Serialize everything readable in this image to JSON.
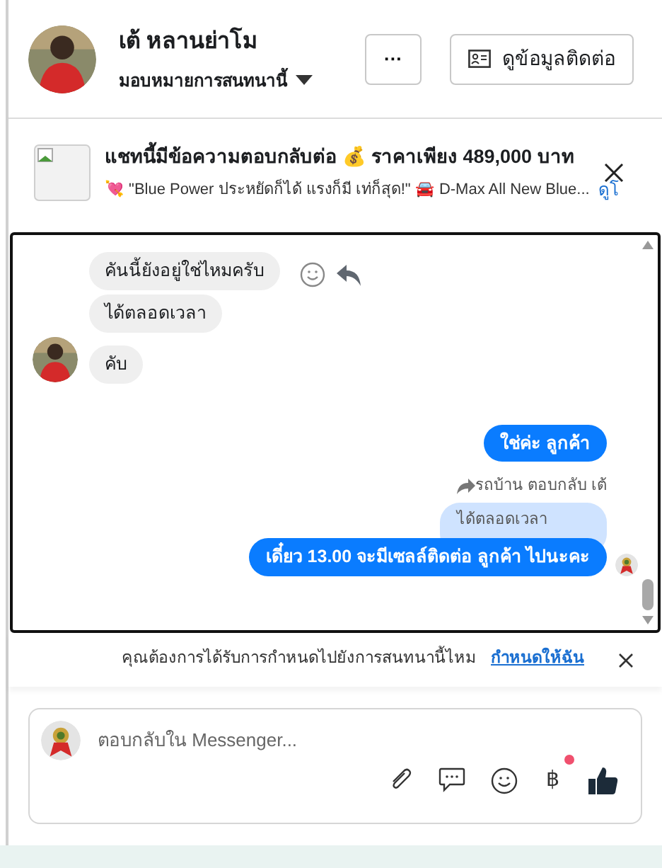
{
  "header": {
    "name": "เต้ หลานย่าโม",
    "assign_label": "มอบหมายการสนทนานี้",
    "more_button": "···",
    "contact_button": "ดูข้อมูลติดต่อ"
  },
  "banner": {
    "title": "แชทนี้มีข้อความตอบกลับต่อ 💰 ราคาเพียง 489,000 บาท",
    "subtitle": "💘 \"Blue Power ประหยัดก็ได้ แรงก็มี เท่ก็สุด!\" 🚘 D-Max All New Blue...",
    "link": "ดูโ"
  },
  "messages": [
    {
      "kind": "incoming",
      "text": "คันนี้ยังอยู่ใช่ไหมครับ",
      "show_actions": true,
      "show_avatar": false
    },
    {
      "kind": "incoming",
      "text": "ได้ตลอดเวลา",
      "show_actions": false,
      "show_avatar": false
    },
    {
      "kind": "incoming",
      "text": "คับ",
      "show_actions": false,
      "show_avatar": true
    },
    {
      "kind": "outgoing",
      "text": "ใช่ค่ะ  ลูกค้า",
      "seen": false
    },
    {
      "kind": "reply_note",
      "text": "รถบ้าน ตอบกลับ เต้"
    },
    {
      "kind": "quoted",
      "text": "ได้ตลอดเวลา"
    },
    {
      "kind": "outgoing",
      "text": "เดี๋ยว 13.00 จะมีเซลล์ติดต่อ ลูกค้า ไปนะคะ",
      "seen": true
    }
  ],
  "notice": {
    "text": "คุณต้องการได้รับการกำหนดไปยังการสนทนานี้ไหม",
    "link": "กำหนดให้ฉัน"
  },
  "composer": {
    "placeholder": "ตอบกลับใน Messenger...",
    "payment_icon": "฿",
    "payment_badge": true
  }
}
